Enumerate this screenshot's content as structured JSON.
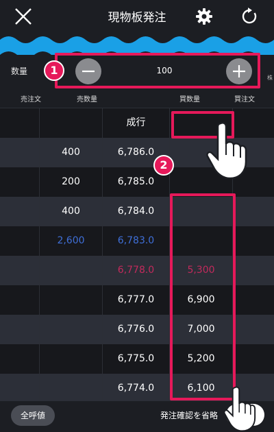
{
  "header": {
    "title": "現物板発注",
    "close_icon": "close-icon",
    "settings_icon": "gear-icon",
    "refresh_icon": "refresh-icon"
  },
  "quantity": {
    "label": "数量",
    "value": "100",
    "unit": "株"
  },
  "columns": {
    "sell_order": "売注文",
    "sell_qty": "売数量",
    "buy_qty": "買数量",
    "buy_order": "買注文"
  },
  "board": {
    "market_label": "成行",
    "rows": [
      {
        "sell_qty": "400",
        "price": "6,786.0",
        "buy_qty": ""
      },
      {
        "sell_qty": "200",
        "price": "6,785.0",
        "buy_qty": ""
      },
      {
        "sell_qty": "400",
        "price": "6,784.0",
        "buy_qty": ""
      },
      {
        "sell_qty": "2,600",
        "price": "6,783.0",
        "buy_qty": ""
      },
      {
        "sell_qty": "",
        "price": "6,778.0",
        "buy_qty": "5,300"
      },
      {
        "sell_qty": "",
        "price": "6,777.0",
        "buy_qty": "6,900"
      },
      {
        "sell_qty": "",
        "price": "6,776.0",
        "buy_qty": "7,000"
      },
      {
        "sell_qty": "",
        "price": "6,775.0",
        "buy_qty": "5,200"
      },
      {
        "sell_qty": "",
        "price": "6,774.0",
        "buy_qty": "6,100"
      }
    ]
  },
  "footer": {
    "all_price_button": "全呼値",
    "skip_confirm_label": "発注確認を省略"
  },
  "annotations": {
    "badge_1": "1",
    "badge_2": "2",
    "highlight_color": "#e6195a"
  },
  "colors": {
    "background": "#1c1e23",
    "wave": "#1aa0e6",
    "best_ask": "#3f6fd8",
    "best_bid": "#c22a5c"
  }
}
